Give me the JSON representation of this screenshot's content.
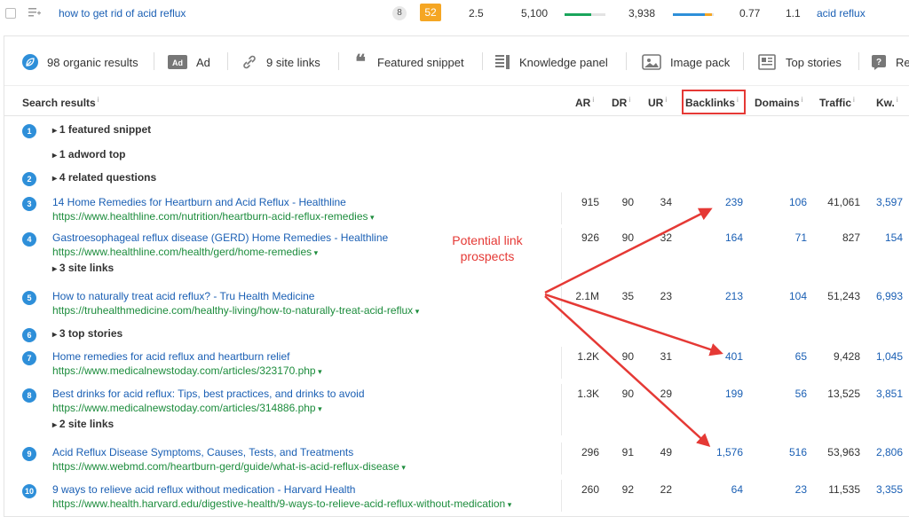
{
  "keyword_row": {
    "keyword": "how to get rid of acid reflux",
    "serp_features": "8",
    "kd": "52",
    "cpc": "2.5",
    "volume": "5,100",
    "traffic_potential": "3,938",
    "cps": "0.77",
    "rr": "1.1",
    "parent_topic": "acid reflux"
  },
  "features": [
    {
      "label": "98 organic results",
      "icon": "leaf-icon"
    },
    {
      "label": "Ad",
      "icon": "ad-icon"
    },
    {
      "label": "9 site links",
      "icon": "link-icon"
    },
    {
      "label": "Featured snippet",
      "icon": "quote-icon"
    },
    {
      "label": "Knowledge panel",
      "icon": "knowledge-panel-icon"
    },
    {
      "label": "Image pack",
      "icon": "image-icon"
    },
    {
      "label": "Top stories",
      "icon": "news-icon"
    },
    {
      "label": "Re",
      "icon": "question-icon"
    }
  ],
  "table": {
    "headers": {
      "results": "Search results",
      "ar": "AR",
      "dr": "DR",
      "ur": "UR",
      "backlinks": "Backlinks",
      "domains": "Domains",
      "traffic": "Traffic",
      "kw": "Kw."
    },
    "info_mark": "i",
    "rows": [
      {
        "type": "group",
        "pos": "1",
        "label": "1 featured snippet"
      },
      {
        "type": "group",
        "pos": "",
        "label": "1 adword top"
      },
      {
        "type": "group",
        "pos": "2",
        "label": "4 related questions"
      },
      {
        "type": "result",
        "pos": "3",
        "title": "14 Home Remedies for Heartburn and Acid Reflux - Healthline",
        "url": "https://www.healthline.com/nutrition/heartburn-acid-reflux-remedies",
        "ar": "915",
        "dr": "90",
        "ur": "34",
        "backlinks": "239",
        "domains": "106",
        "traffic": "41,061",
        "kw": "3,597"
      },
      {
        "type": "result",
        "pos": "4",
        "title": "Gastroesophageal reflux disease (GERD) Home Remedies - Healthline",
        "url": "https://www.healthline.com/health/gerd/home-remedies",
        "ar": "926",
        "dr": "90",
        "ur": "32",
        "backlinks": "164",
        "domains": "71",
        "traffic": "827",
        "kw": "154",
        "sub": "3 site links"
      },
      {
        "type": "result",
        "pos": "5",
        "title": "How to naturally treat acid reflux? - Tru Health Medicine",
        "url": "https://truhealthmedicine.com/healthy-living/how-to-naturally-treat-acid-reflux",
        "ar": "2.1M",
        "dr": "35",
        "ur": "23",
        "backlinks": "213",
        "domains": "104",
        "traffic": "51,243",
        "kw": "6,993"
      },
      {
        "type": "group",
        "pos": "6",
        "label": "3 top stories"
      },
      {
        "type": "result",
        "pos": "7",
        "title": "Home remedies for acid reflux and heartburn relief",
        "url": "https://www.medicalnewstoday.com/articles/323170.php",
        "ar": "1.2K",
        "dr": "90",
        "ur": "31",
        "backlinks": "401",
        "domains": "65",
        "traffic": "9,428",
        "kw": "1,045"
      },
      {
        "type": "result",
        "pos": "8",
        "title": "Best drinks for acid reflux: Tips, best practices, and drinks to avoid",
        "url": "https://www.medicalnewstoday.com/articles/314886.php",
        "ar": "1.3K",
        "dr": "90",
        "ur": "29",
        "backlinks": "199",
        "domains": "56",
        "traffic": "13,525",
        "kw": "3,851",
        "sub": "2 site links"
      },
      {
        "type": "result",
        "pos": "9",
        "title": "Acid Reflux Disease Symptoms, Causes, Tests, and Treatments",
        "url": "https://www.webmd.com/heartburn-gerd/guide/what-is-acid-reflux-disease",
        "ar": "296",
        "dr": "91",
        "ur": "49",
        "backlinks": "1,576",
        "domains": "516",
        "traffic": "53,963",
        "kw": "2,806"
      },
      {
        "type": "result",
        "pos": "10",
        "title": "9 ways to relieve acid reflux without medication - Harvard Health",
        "url": "https://www.health.harvard.edu/digestive-health/9-ways-to-relieve-acid-reflux-without-medication",
        "ar": "260",
        "dr": "92",
        "ur": "22",
        "backlinks": "64",
        "domains": "23",
        "traffic": "11,535",
        "kw": "3,355"
      }
    ]
  },
  "annotation": {
    "line1": "Potential link",
    "line2": "prospects",
    "color": "#e53935"
  }
}
